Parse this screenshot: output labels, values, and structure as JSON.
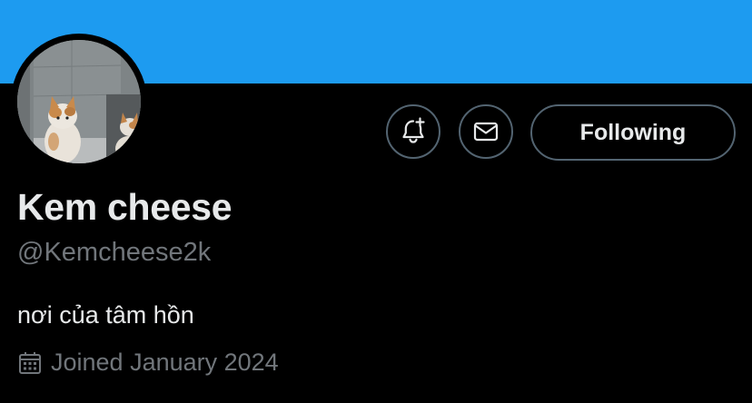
{
  "profile": {
    "banner_color": "#1d9bf0",
    "avatar_icon": "cat-photo-avatar",
    "display_name": "Kem cheese",
    "handle": "@Kemcheese2k",
    "bio": "nơi của tâm hồn",
    "joined": "Joined January 2024"
  },
  "actions": {
    "notify_icon": "bell-plus-icon",
    "message_icon": "envelope-icon",
    "following_label": "Following"
  },
  "icons": {
    "joined_icon": "calendar-icon"
  },
  "colors": {
    "background": "#000000",
    "text_primary": "#e7e9ea",
    "text_secondary": "#71767b",
    "border": "#536471",
    "accent": "#1d9bf0"
  }
}
